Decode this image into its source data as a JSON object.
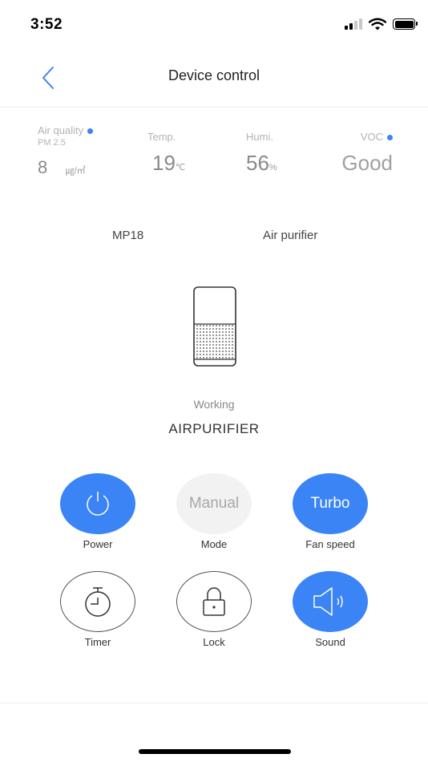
{
  "status_bar": {
    "time": "3:52"
  },
  "nav": {
    "title": "Device control"
  },
  "sensors": {
    "air_quality": {
      "label": "Air quality",
      "sublabel": "PM 2.5",
      "value": "8",
      "unit": "㎍/㎥"
    },
    "temp": {
      "label": "Temp.",
      "value": "19",
      "unit": "℃"
    },
    "humi": {
      "label": "Humi.",
      "value": "56",
      "unit": "%"
    },
    "voc": {
      "label": "VOC",
      "value": "Good"
    }
  },
  "device": {
    "model": "MP18",
    "type": "Air purifier"
  },
  "status": {
    "state": "Working",
    "mode": "AIRPURIFIER"
  },
  "controls": {
    "power": {
      "label": "Power",
      "icon": "power-icon"
    },
    "mode": {
      "label": "Mode",
      "value": "Manual"
    },
    "fan_speed": {
      "label": "Fan speed",
      "value": "Turbo"
    },
    "timer": {
      "label": "Timer",
      "icon": "timer-icon"
    },
    "lock": {
      "label": "Lock",
      "icon": "lock-icon"
    },
    "sound": {
      "label": "Sound",
      "icon": "speaker-icon"
    }
  },
  "colors": {
    "accent": "#3a84f5",
    "inactive": "#f2f2f2"
  }
}
